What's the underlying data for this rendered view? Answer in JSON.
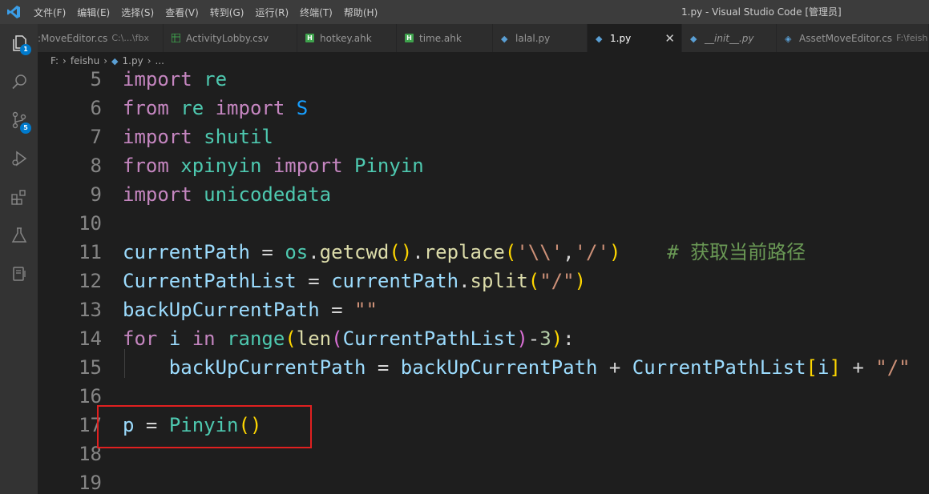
{
  "titlebar": {
    "menu": [
      "文件(F)",
      "编辑(E)",
      "选择(S)",
      "查看(V)",
      "转到(G)",
      "运行(R)",
      "终端(T)",
      "帮助(H)"
    ],
    "window_title": "1.py - Visual Studio Code [管理员]"
  },
  "activity_bar": {
    "explorer_badge": "1",
    "scm_badge": "5"
  },
  "tabs": [
    {
      "label": ":MoveEditor.cs",
      "path": "C:\\...\\fbx",
      "icon": "csharp-icon"
    },
    {
      "label": "ActivityLobby.csv",
      "icon": "csv-icon"
    },
    {
      "label": "hotkey.ahk",
      "icon": "ahk-icon"
    },
    {
      "label": "time.ahk",
      "icon": "ahk-icon"
    },
    {
      "label": "lalal.py",
      "icon": "python-icon"
    },
    {
      "label": "1.py",
      "icon": "python-icon",
      "active": true
    },
    {
      "label": "__init__.py",
      "icon": "python-icon"
    },
    {
      "label": "AssetMoveEditor.cs",
      "path": "F:\\feishu",
      "icon": "csharp-icon"
    }
  ],
  "breadcrumb": {
    "drive": "F:",
    "folder": "feishu",
    "file": "1.py",
    "more": "..."
  },
  "editor": {
    "line_numbers": [
      "5",
      "6",
      "7",
      "8",
      "9",
      "10",
      "11",
      "12",
      "13",
      "14",
      "15",
      "16",
      "17",
      "18",
      "19"
    ],
    "lines": [
      [
        {
          "t": "import",
          "c": "kw"
        },
        {
          "t": " ",
          "c": "op"
        },
        {
          "t": "re",
          "c": "mod"
        }
      ],
      [
        {
          "t": "from",
          "c": "kw"
        },
        {
          "t": " ",
          "c": "op"
        },
        {
          "t": "re",
          "c": "mod"
        },
        {
          "t": " ",
          "c": "op"
        },
        {
          "t": "import",
          "c": "kw"
        },
        {
          "t": " ",
          "c": "op"
        },
        {
          "t": "S",
          "c": "b3"
        }
      ],
      [
        {
          "t": "import",
          "c": "kw"
        },
        {
          "t": " ",
          "c": "op"
        },
        {
          "t": "shutil",
          "c": "mod"
        }
      ],
      [
        {
          "t": "from",
          "c": "kw"
        },
        {
          "t": " ",
          "c": "op"
        },
        {
          "t": "xpinyin",
          "c": "mod"
        },
        {
          "t": " ",
          "c": "op"
        },
        {
          "t": "import",
          "c": "kw"
        },
        {
          "t": " ",
          "c": "op"
        },
        {
          "t": "Pinyin",
          "c": "mod"
        }
      ],
      [
        {
          "t": "import",
          "c": "kw"
        },
        {
          "t": " ",
          "c": "op"
        },
        {
          "t": "unicodedata",
          "c": "mod"
        }
      ],
      [],
      [
        {
          "t": "currentPath",
          "c": "var"
        },
        {
          "t": " = ",
          "c": "op"
        },
        {
          "t": "os",
          "c": "mod"
        },
        {
          "t": ".",
          "c": "op"
        },
        {
          "t": "getcwd",
          "c": "fn"
        },
        {
          "t": "()",
          "c": "b1"
        },
        {
          "t": ".",
          "c": "op"
        },
        {
          "t": "replace",
          "c": "fn"
        },
        {
          "t": "(",
          "c": "b1"
        },
        {
          "t": "'\\\\'",
          "c": "str"
        },
        {
          "t": ",",
          "c": "op"
        },
        {
          "t": "'/'",
          "c": "str"
        },
        {
          "t": ")",
          "c": "b1"
        },
        {
          "t": "    ",
          "c": "op"
        },
        {
          "t": "# 获取当前路径",
          "c": "cm"
        }
      ],
      [
        {
          "t": "CurrentPathList",
          "c": "var"
        },
        {
          "t": " = ",
          "c": "op"
        },
        {
          "t": "currentPath",
          "c": "var"
        },
        {
          "t": ".",
          "c": "op"
        },
        {
          "t": "split",
          "c": "fn"
        },
        {
          "t": "(",
          "c": "b1"
        },
        {
          "t": "\"/\"",
          "c": "str"
        },
        {
          "t": ")",
          "c": "b1"
        }
      ],
      [
        {
          "t": "backUpCurrentPath",
          "c": "var"
        },
        {
          "t": " = ",
          "c": "op"
        },
        {
          "t": "\"\"",
          "c": "str"
        }
      ],
      [
        {
          "t": "for",
          "c": "kw"
        },
        {
          "t": " ",
          "c": "op"
        },
        {
          "t": "i",
          "c": "var"
        },
        {
          "t": " ",
          "c": "op"
        },
        {
          "t": "in",
          "c": "kw"
        },
        {
          "t": " ",
          "c": "op"
        },
        {
          "t": "range",
          "c": "mod"
        },
        {
          "t": "(",
          "c": "b1"
        },
        {
          "t": "len",
          "c": "fn"
        },
        {
          "t": "(",
          "c": "b2"
        },
        {
          "t": "CurrentPathList",
          "c": "var"
        },
        {
          "t": ")",
          "c": "b2"
        },
        {
          "t": "-",
          "c": "op"
        },
        {
          "t": "3",
          "c": "num"
        },
        {
          "t": ")",
          "c": "b1"
        },
        {
          "t": ":",
          "c": "op"
        }
      ],
      [
        {
          "t": "    ",
          "c": "op"
        },
        {
          "t": "backUpCurrentPath",
          "c": "var"
        },
        {
          "t": " = ",
          "c": "op"
        },
        {
          "t": "backUpCurrentPath",
          "c": "var"
        },
        {
          "t": " + ",
          "c": "op"
        },
        {
          "t": "CurrentPathList",
          "c": "var"
        },
        {
          "t": "[",
          "c": "b1"
        },
        {
          "t": "i",
          "c": "var"
        },
        {
          "t": "]",
          "c": "b1"
        },
        {
          "t": " + ",
          "c": "op"
        },
        {
          "t": "\"/\"",
          "c": "str"
        }
      ],
      [],
      [
        {
          "t": "p",
          "c": "var"
        },
        {
          "t": " = ",
          "c": "op"
        },
        {
          "t": "Pinyin",
          "c": "mod"
        },
        {
          "t": "()",
          "c": "b1"
        }
      ],
      [],
      []
    ]
  },
  "colors": {
    "highlight_box": "#e02020",
    "accent": "#007acc"
  }
}
